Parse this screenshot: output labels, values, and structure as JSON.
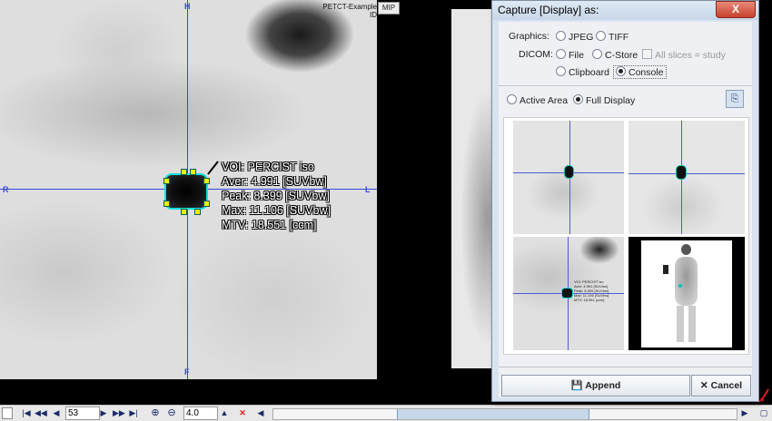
{
  "viewport": {
    "header_label": "PETCT-Example",
    "header_sub": "ID",
    "mip_button": "MIP",
    "orientation": {
      "top": "H",
      "bottom": "F",
      "left": "R",
      "right": "L"
    },
    "voi_info": {
      "voi": "VOI: PERCIST iso",
      "aver": "Aver: 4.991 [SUVbw]",
      "peak": "Peak: 8.399 [SUVbw]",
      "max": "Max: 11.106 [SUVbw]",
      "mtv": "MTV: 18.551 [ccm]"
    }
  },
  "toolbar": {
    "slice_value": "53",
    "zoom_value": "4.0"
  },
  "dialog": {
    "title": "Capture [Display] as:",
    "close_label": "X",
    "graphics_label": "Graphics:",
    "dicom_label": "DICOM:",
    "options": {
      "jpeg": "JPEG",
      "tiff": "TIFF",
      "file": "File",
      "cstore": "C-Store",
      "all_slices": "All slices = study",
      "clipboard": "Clipboard",
      "console": "Console"
    },
    "selected_output": "Console",
    "active_area": "Active Area",
    "full_display": "Full Display",
    "selected_area": "Full Display",
    "append_label": "Append",
    "cancel_label": "Cancel"
  },
  "preview": {
    "voi_lines": [
      "VOI: PERCIST iso",
      "Aver: 4.991 [SUVbw]",
      "Peak: 8.399 [SUVbw]",
      "Max: 11.106 [SUVbw]",
      "MTV: 18.551 [ccm]"
    ]
  },
  "colors": {
    "crosshair": "#3848d8",
    "voi_contour": "#10e0e0",
    "dialog_bg": "#d8e3ef",
    "close_button": "#c7412c"
  }
}
